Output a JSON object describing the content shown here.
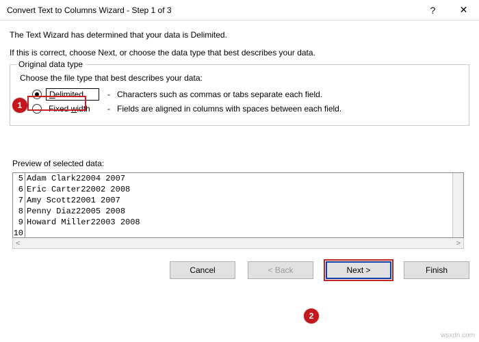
{
  "title": "Convert Text to Columns Wizard - Step 1 of 3",
  "helpGlyph": "?",
  "closeGlyph": "✕",
  "intro1": "The Text Wizard has determined that your data is Delimited.",
  "intro2": "If this is correct, choose Next, or choose the data type that best describes your data.",
  "fieldset": {
    "legend": "Original data type",
    "choose": "Choose the file type that best describes your data:",
    "delimited": {
      "prefix": "D",
      "rest": "elimited",
      "desc": "Characters such as commas or tabs separate each field."
    },
    "fixed": {
      "prefix": "Fixed ",
      "ul": "w",
      "rest": "idth",
      "desc": "Fields are aligned in columns with spaces between each field."
    }
  },
  "dash": "-",
  "previewLabel": "Preview of selected data:",
  "previewRows": [
    {
      "n": "5",
      "t": "Adam Clark22004 2007"
    },
    {
      "n": "6",
      "t": "Eric Carter22002 2008"
    },
    {
      "n": "7",
      "t": "Amy Scott22001 2007"
    },
    {
      "n": "8",
      "t": "Penny Diaz22005 2008"
    },
    {
      "n": "9",
      "t": "Howard Miller22003 2008"
    },
    {
      "n": "10",
      "t": ""
    }
  ],
  "scrollLeft": "<",
  "scrollRight": ">",
  "buttons": {
    "cancel": "Cancel",
    "back": "< Back",
    "next": "Next >",
    "finish": "Finish"
  },
  "markers": {
    "m1": "1",
    "m2": "2"
  },
  "watermark": "wsxdn.com"
}
